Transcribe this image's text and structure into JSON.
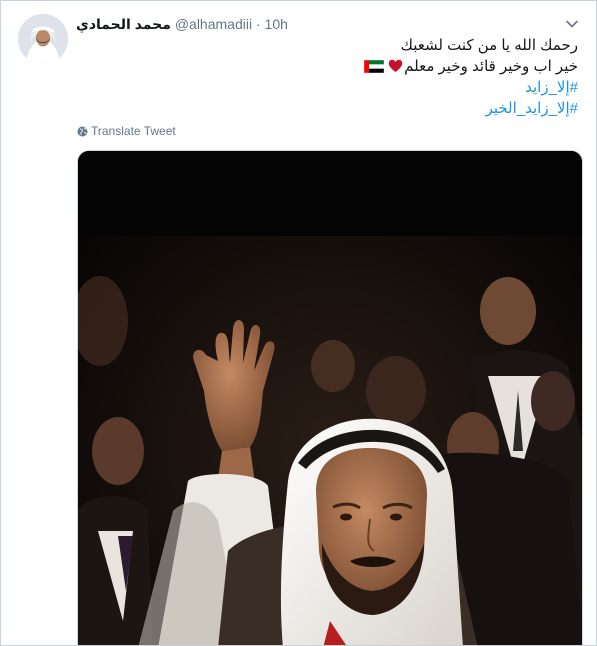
{
  "tweet": {
    "display_name": "محمد الحمادي",
    "handle": "@alhamadiii",
    "separator": "·",
    "time": "10h",
    "lines": [
      "رحمك الله يا من كنت لشعبك",
      "خير اب وخير قائد وخير معلم"
    ],
    "hashtags": [
      "#إلا_زايد",
      "#إلا_زايد_الخير"
    ],
    "translate_label": "Translate Tweet"
  },
  "icons": {
    "menu": "chevron-down-icon",
    "flag": "uae-flag-icon",
    "heart": "heart-icon",
    "translate": "globe-icon"
  },
  "colors": {
    "name": "#14171a",
    "secondary": "#657786",
    "link": "#1b95e0",
    "heart": "#e0245e"
  }
}
